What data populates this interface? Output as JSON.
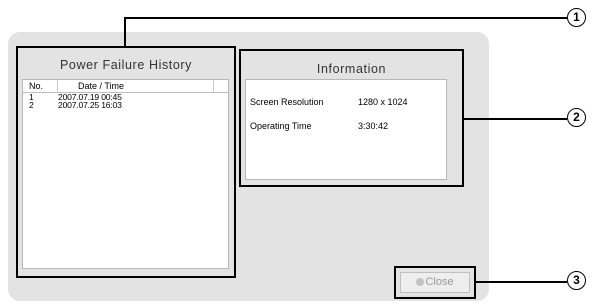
{
  "power_failure_history": {
    "title": "Power Failure History",
    "columns": [
      "No.",
      "Date / Time"
    ],
    "rows": [
      {
        "no": "1",
        "datetime": "2007.07.19 00:45"
      },
      {
        "no": "2",
        "datetime": "2007.07.25 16:03"
      }
    ]
  },
  "information": {
    "title": "Information",
    "rows": [
      {
        "label": "Screen Resolution",
        "value": "1280 x 1024"
      },
      {
        "label": "Operating Time",
        "value": "3:30:42"
      }
    ]
  },
  "close_button": {
    "label": "Close"
  },
  "callouts": [
    "1",
    "2",
    "3"
  ]
}
